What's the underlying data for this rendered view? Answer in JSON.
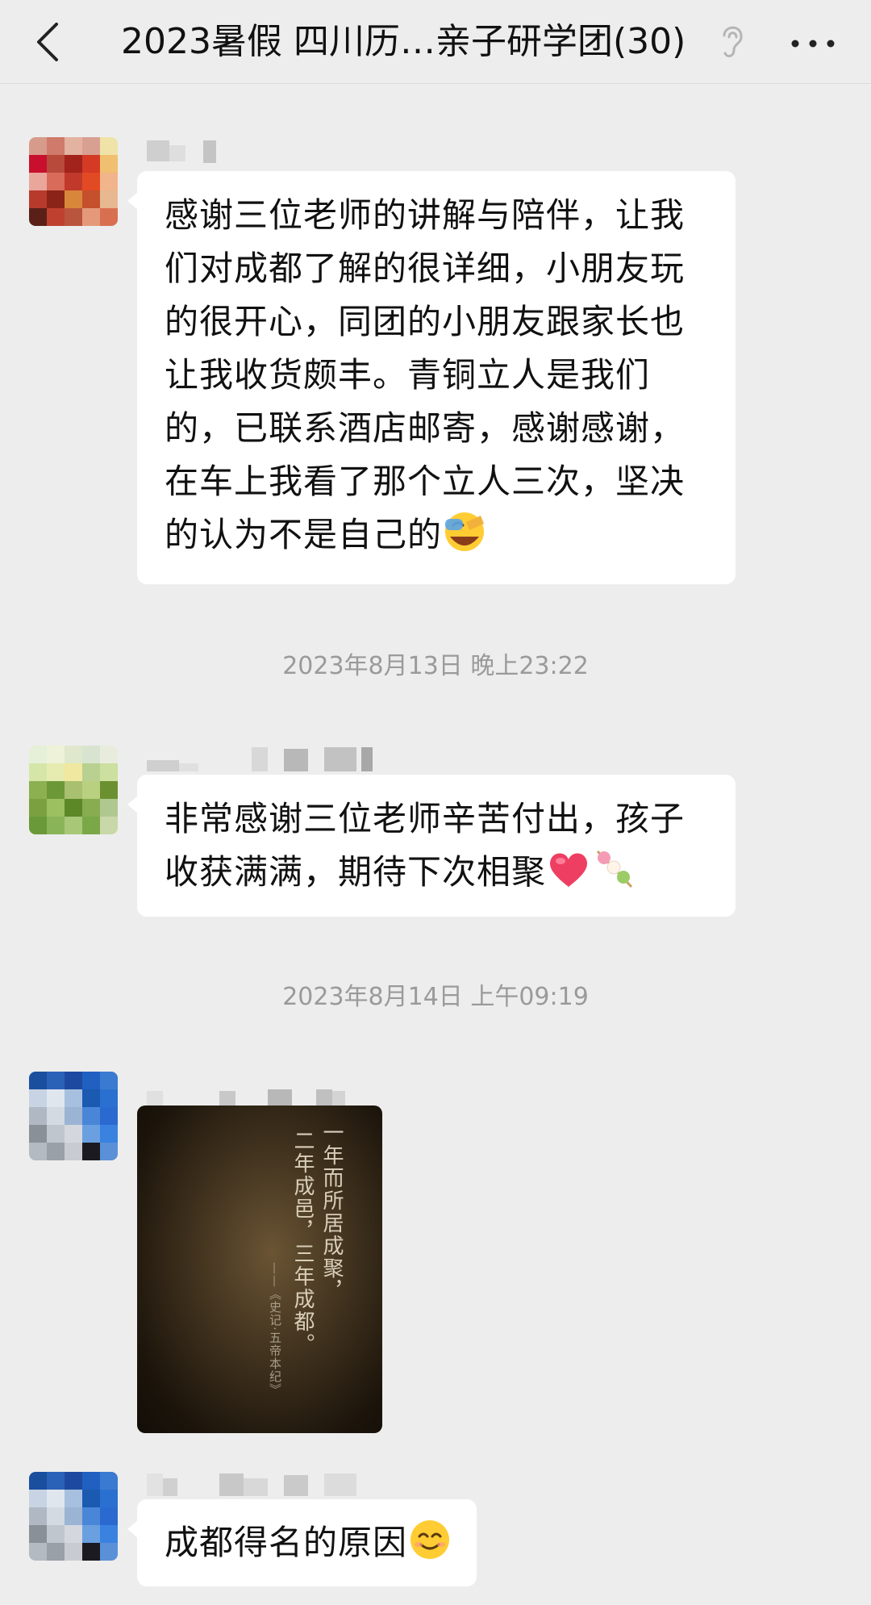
{
  "header": {
    "title": "2023暑假 四川历…亲子研学团(30)",
    "back_icon": "chevron-left-icon",
    "ear_icon": "ear-icon",
    "more_icon": "more-dots-icon"
  },
  "messages": [
    {
      "type": "text",
      "text": "感谢三位老师的讲解与陪伴，让我们对成都了解的很详细，小朋友玩的很开心，同团的小朋友跟家长也让我收货颇丰。青铜立人是我们的，已联系酒店邮寄，感谢感谢，在车上我看了那个立人三次，坚决的认为不是自己的",
      "emoji": "facepalm-laugh-emoji"
    },
    {
      "type": "timestamp",
      "text": "2023年8月13日 晚上23:22"
    },
    {
      "type": "text",
      "text": "非常感谢三位老师辛苦付出，孩子收获满满，期待下次相聚",
      "emoji": [
        "heart-emoji",
        "dango-emoji"
      ]
    },
    {
      "type": "timestamp",
      "text": "2023年8月14日 上午09:19"
    },
    {
      "type": "image",
      "poem": {
        "line1": "一年而所居成聚，",
        "line2": "二年成邑，三年成都。",
        "source": "——《史记·五帝本纪》"
      }
    },
    {
      "type": "text",
      "text": "成都得名的原因",
      "emoji": "smile-emoji"
    }
  ],
  "colors": {
    "background": "#ededed",
    "bubble": "#ffffff",
    "timestamp": "#9a9a9a"
  }
}
